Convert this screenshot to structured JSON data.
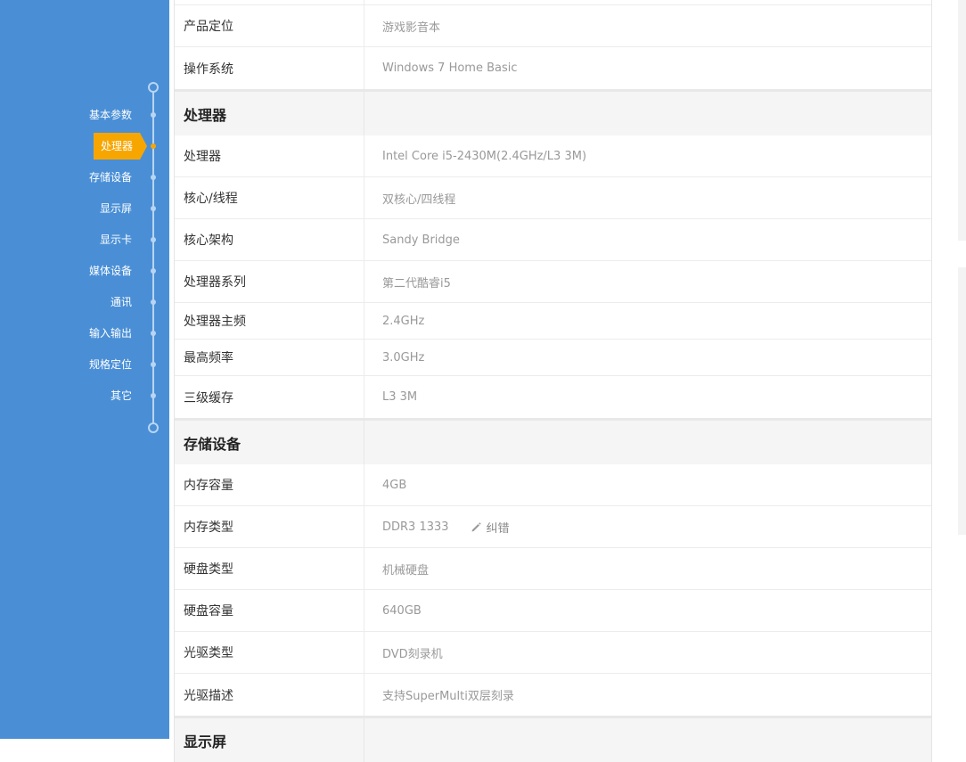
{
  "sidebar": {
    "items": [
      {
        "label": "基本参数"
      },
      {
        "label": "处理器"
      },
      {
        "label": "存储设备"
      },
      {
        "label": "显示屏"
      },
      {
        "label": "显示卡"
      },
      {
        "label": "媒体设备"
      },
      {
        "label": "通讯"
      },
      {
        "label": "输入输出"
      },
      {
        "label": "规格定位"
      },
      {
        "label": "其它"
      }
    ],
    "active_index": 1
  },
  "colors": {
    "nav_bg": "#4a8fd6",
    "accent": "#f7a600"
  },
  "basic": {
    "rows": [
      {
        "key": "产品定位",
        "value": "游戏影音本"
      },
      {
        "key": "操作系统",
        "value": "Windows 7 Home Basic"
      }
    ]
  },
  "cpu": {
    "title": "处理器",
    "rows": [
      {
        "key": "处理器",
        "value": "Intel Core i5-2430M(2.4GHz/L3 3M)"
      },
      {
        "key": "核心/线程",
        "value": "双核心/四线程"
      },
      {
        "key": "核心架构",
        "value": "Sandy Bridge"
      },
      {
        "key": "处理器系列",
        "value": "第二代酷睿i5"
      },
      {
        "key": "处理器主频",
        "value": "2.4GHz"
      },
      {
        "key": "最高频率",
        "value": "3.0GHz"
      },
      {
        "key": "三级缓存",
        "value": "L3 3M"
      }
    ]
  },
  "storage": {
    "title": "存储设备",
    "rows": [
      {
        "key": "内存容量",
        "value": "4GB"
      },
      {
        "key": "内存类型",
        "value": "DDR3 1333",
        "action": "纠错"
      },
      {
        "key": "硬盘类型",
        "value": "机械硬盘"
      },
      {
        "key": "硬盘容量",
        "value": "640GB"
      },
      {
        "key": "光驱类型",
        "value": "DVD刻录机"
      },
      {
        "key": "光驱描述",
        "value": "支持SuperMulti双层刻录"
      }
    ]
  },
  "display": {
    "title": "显示屏"
  }
}
